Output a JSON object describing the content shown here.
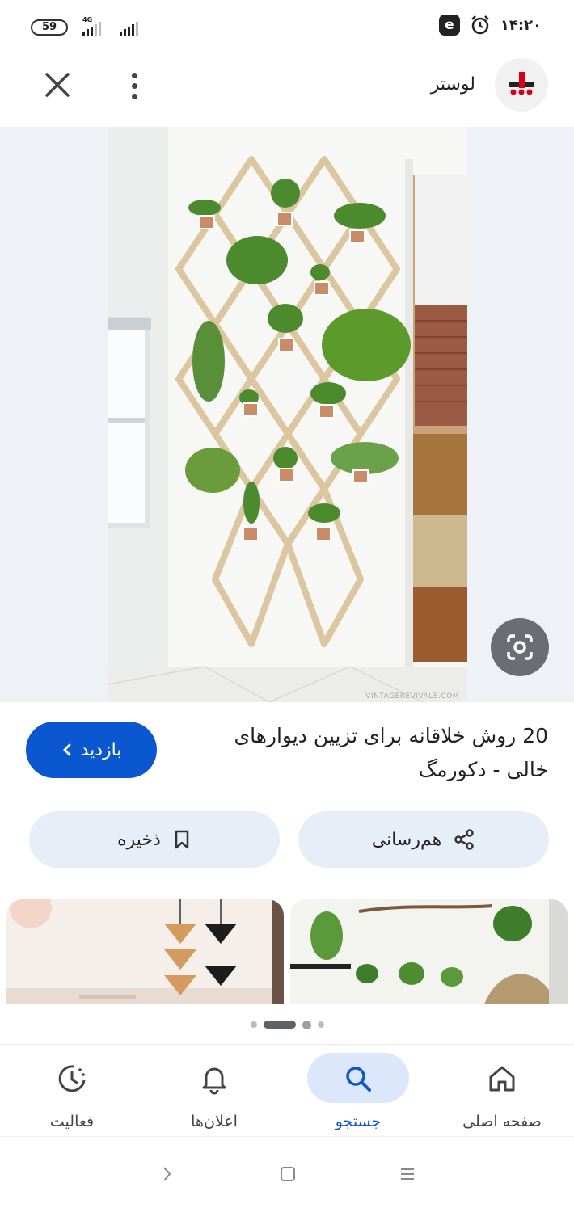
{
  "status_bar": {
    "battery": "59",
    "network": "4G",
    "time": "۱۴:۲۰",
    "app_icon": "e-app-icon",
    "alarm_icon": "alarm-icon"
  },
  "app_bar": {
    "site_name": "لوستر",
    "close_icon": "close-icon",
    "more_icon": "more-vert-icon"
  },
  "image": {
    "watermark": "VINTAGEREVIVALS.COM",
    "lens_icon": "google-lens-icon"
  },
  "result": {
    "title": "20 روش خلاقانه برای تزیین دیوارهای خالی - دکورمگ",
    "visit_label": "بازدید",
    "share_label": "هم‌رسانی",
    "save_label": "ذخیره"
  },
  "bottom_nav": {
    "items": [
      {
        "label": "صفحه اصلی",
        "icon": "home-icon"
      },
      {
        "label": "جستجو",
        "icon": "search-icon",
        "active": true
      },
      {
        "label": "اعلان‌ها",
        "icon": "bell-icon"
      },
      {
        "label": "فعالیت",
        "icon": "activity-icon"
      }
    ]
  },
  "colors": {
    "accent": "#0b57d0",
    "chip_bg": "#e8eef8",
    "nav_pill": "#dde7fb"
  }
}
